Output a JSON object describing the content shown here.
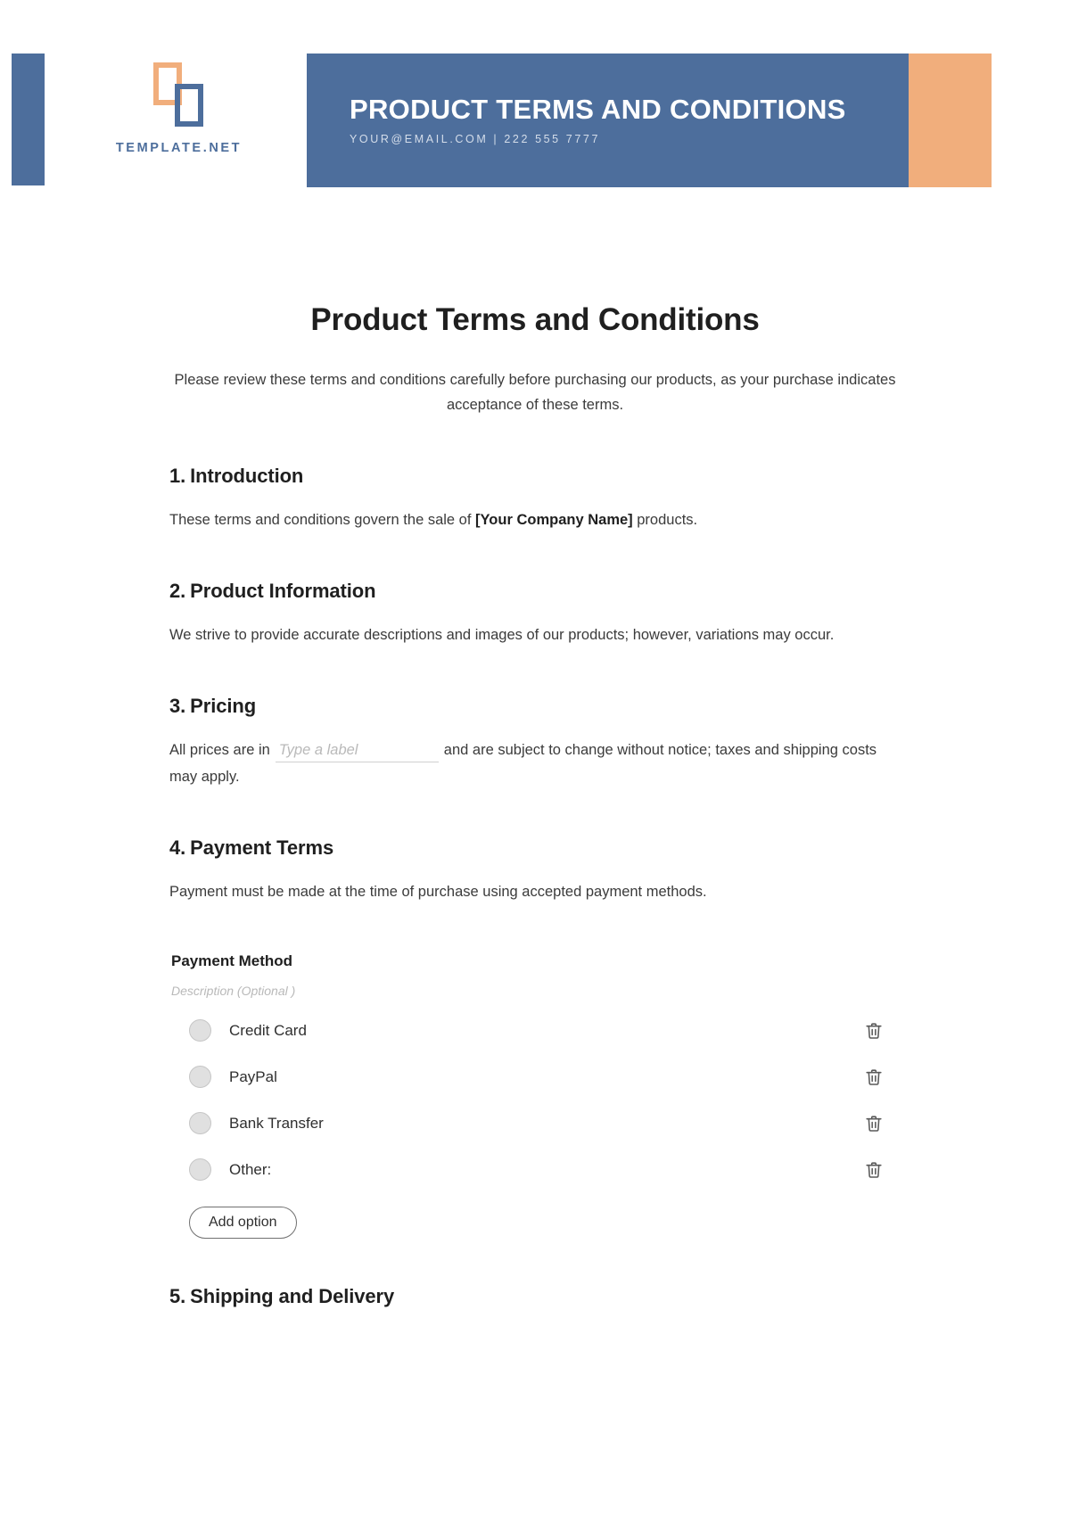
{
  "header": {
    "logo": {
      "wordmark": "TEMPLATE.NET",
      "mark_back_color": "#f1ae7c",
      "mark_front_color": "#4d6e9c"
    },
    "band_title": "PRODUCT TERMS AND CONDITIONS",
    "band_contact": "YOUR@EMAIL.COM | 222 555 7777",
    "band_color": "#4d6e9c",
    "accent_color": "#f1ae7c"
  },
  "document": {
    "title": "Product Terms and Conditions",
    "intro": "Please review these terms and conditions carefully before purchasing our products, as your purchase indicates acceptance of these terms.",
    "sections": [
      {
        "number": "1.",
        "heading": "Introduction",
        "body_pre": "These terms and conditions govern the sale of ",
        "body_bold": "[Your Company Name]",
        "body_post": " products."
      },
      {
        "number": "2.",
        "heading": "Product Information",
        "body": "We strive to provide accurate descriptions and images of our products; however, variations may occur."
      },
      {
        "number": "3.",
        "heading": "Pricing",
        "body_pre": "All prices are in",
        "input_placeholder": "Type a label",
        "body_post": "and are subject to change without notice; taxes and shipping costs may apply."
      },
      {
        "number": "4.",
        "heading": "Payment Terms",
        "body": "Payment must be made at the time of purchase using accepted payment methods."
      },
      {
        "number": "5.",
        "heading": "Shipping and Delivery"
      }
    ]
  },
  "question": {
    "title": "Payment Method",
    "description_placeholder": "Description  (Optional )",
    "options": [
      {
        "label": "Credit Card",
        "delete_icon": "trash-icon"
      },
      {
        "label": "PayPal",
        "delete_icon": "trash-icon"
      },
      {
        "label": "Bank Transfer",
        "delete_icon": "trash-icon"
      },
      {
        "label": "Other:",
        "delete_icon": "trash-icon"
      }
    ],
    "add_option_label": "Add option"
  }
}
